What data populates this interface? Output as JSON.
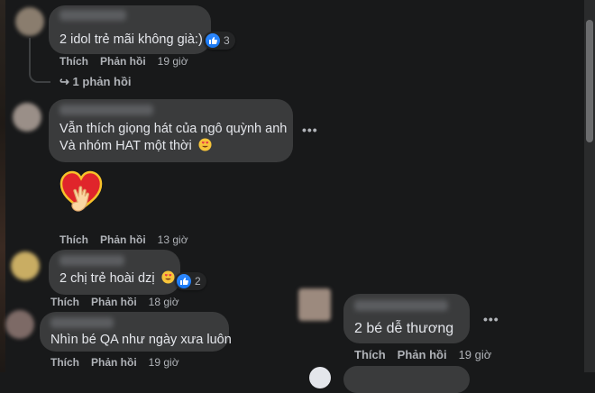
{
  "comments": [
    {
      "text": "2 idol trẻ mãi không già:)",
      "reaction_count": "3",
      "actions": {
        "like": "Thích",
        "reply": "Phản hồi",
        "time": "19 giờ"
      },
      "replies_link": "1 phản hồi"
    },
    {
      "text_line1": "Vẫn thích giọng hát của ngô quỳnh anh",
      "text_line2": "Và nhóm HAT một thời",
      "actions": {
        "like": "Thích",
        "reply": "Phản hồi",
        "time": "13 giờ"
      }
    },
    {
      "text": "2 chị trẻ hoài dzị",
      "reaction_count": "2",
      "actions": {
        "like": "Thích",
        "reply": "Phản hồi",
        "time": "18 giờ"
      }
    },
    {
      "text": "Nhìn bé QA như ngày xưa luôn",
      "actions": {
        "like": "Thích",
        "reply": "Phản hồi",
        "time": "19 giờ"
      }
    },
    {
      "text": "2 bé dễ thương",
      "actions": {
        "like": "Thích",
        "reply": "Phản hồi",
        "time": "19 giờ"
      }
    }
  ],
  "more_label": "•••",
  "reply_arrow": "↪",
  "colors": {
    "background": "#18191a",
    "bubble": "#3a3b3c",
    "like_blue": "#1877f2",
    "muted_text": "#b0b3b8"
  }
}
